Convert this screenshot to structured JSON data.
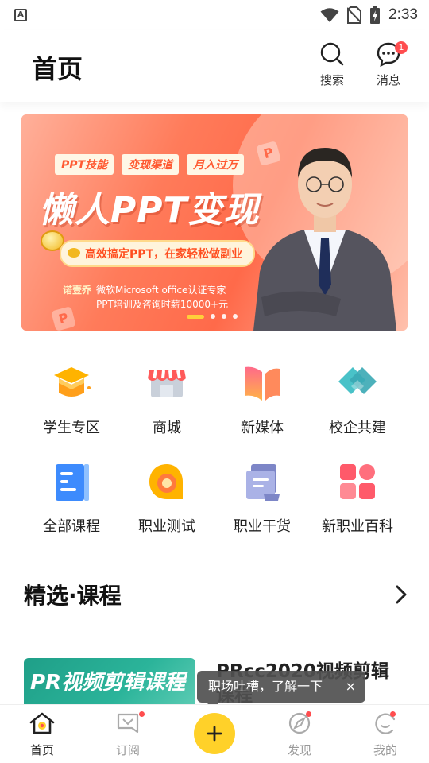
{
  "status_bar": {
    "time": "2:33",
    "left_icon": "A",
    "icons": [
      "wifi-icon",
      "no-sim-icon",
      "battery-charging-icon"
    ]
  },
  "header": {
    "title": "首页",
    "search_label": "搜索",
    "messages_label": "消息",
    "messages_badge": "1"
  },
  "banner": {
    "tags": [
      "PPT技能",
      "变现渠道",
      "月入过万"
    ],
    "title": "懒人PPT变现",
    "pill": "高效搞定PPT，在家轻松做副业",
    "author_name": "诺壹乔",
    "author_line1": "微软Microsoft office认证专家",
    "author_line2": "PPT培训及咨询时薪10000+元",
    "slide_count": 4,
    "active_slide": 1
  },
  "menu": [
    {
      "label": "学生专区",
      "icon": "graduation-cap-icon"
    },
    {
      "label": "商城",
      "icon": "shop-icon"
    },
    {
      "label": "新媒体",
      "icon": "book-icon"
    },
    {
      "label": "校企共建",
      "icon": "handshake-icon"
    },
    {
      "label": "全部课程",
      "icon": "course-list-icon"
    },
    {
      "label": "职业测试",
      "icon": "test-bubble-icon"
    },
    {
      "label": "职业干货",
      "icon": "document-stack-icon"
    },
    {
      "label": "新职业百科",
      "icon": "grid-apps-icon"
    }
  ],
  "section": {
    "title": "精选·课程"
  },
  "course": {
    "thumb_text": "PR视频剪辑课程",
    "title": "PRcc2020视频剪辑课程"
  },
  "toast": {
    "text": "职场吐槽，了解一下",
    "close": "×"
  },
  "tabs": {
    "home": "首页",
    "subscribe": "订阅",
    "discover": "发现",
    "me": "我的",
    "fab": "+"
  },
  "colors": {
    "accent": "#ffd129",
    "badge": "#ff4d4f",
    "banner": "#ff6a4a"
  }
}
